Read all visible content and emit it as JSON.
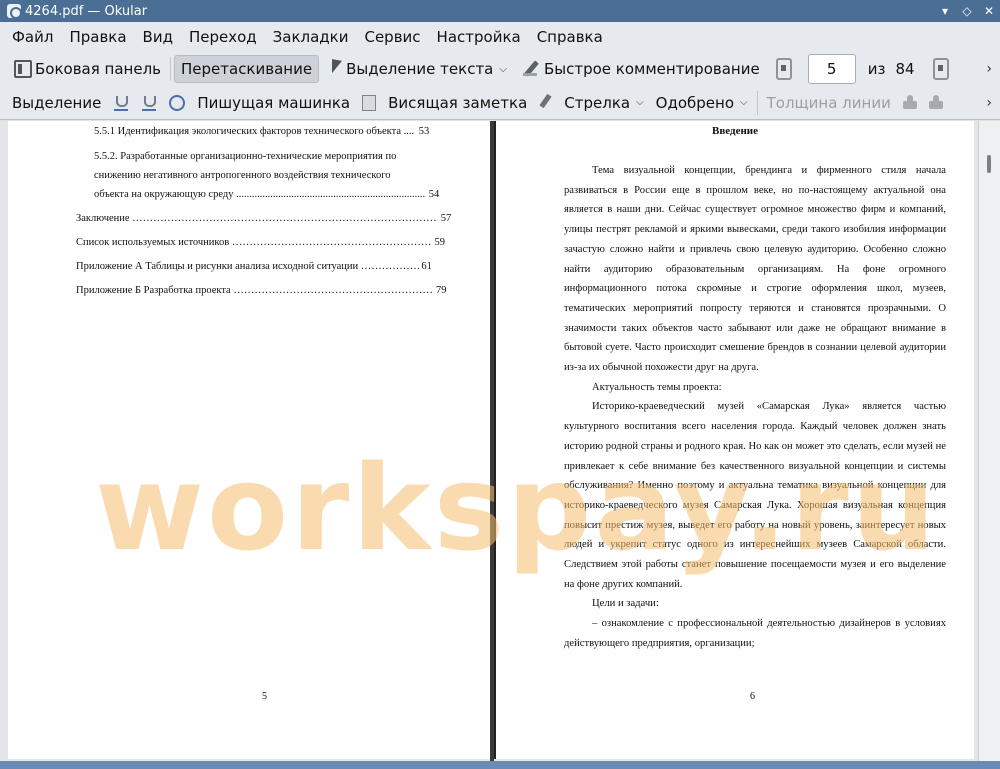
{
  "window": {
    "title": "4264.pdf — Okular",
    "minimize": "▾",
    "maximize": "◇",
    "close": "✕"
  },
  "menu": [
    "Файл",
    "Правка",
    "Вид",
    "Переход",
    "Закладки",
    "Сервис",
    "Настройка",
    "Справка"
  ],
  "toolbar1": {
    "sidebar": "Боковая панель",
    "drag": "Перетаскивание",
    "text_select": "Выделение текста",
    "quick_comment": "Быстрое комментирование",
    "page_current": "5",
    "page_of": "из",
    "page_total": "84",
    "more": "›"
  },
  "toolbar2": {
    "selection": "Выделение",
    "typewriter": "Пишущая машинка",
    "hanging_note": "Висящая заметка",
    "arrow": "Стрелка",
    "approved": "Одобрено",
    "line_width": "Толщина линии",
    "more": "›"
  },
  "left_page": {
    "toc": [
      {
        "text": "5.5.1 Идентификация экологических факторов технического объекта ....",
        "page": "53"
      },
      {
        "text": "5.5.2. Разработанные организационно-технические мероприятия по"
      },
      {
        "text": "снижению негативного антропогенного воздействия технического"
      },
      {
        "text": "объекта на окружающую среду",
        "page": "54"
      },
      {
        "text": "Заключение",
        "page": "57"
      },
      {
        "text": "Список используемых источников",
        "page": "59"
      },
      {
        "text": "Приложение А Таблицы и рисунки анализа исходной ситуации",
        "page": "61"
      },
      {
        "text": "Приложение Б Разработка проекта",
        "page": "79"
      }
    ],
    "page_number": "5"
  },
  "right_page": {
    "heading": "Введение",
    "paragraphs": [
      "Тема визуальной концепции, брендинга и фирменного стиля начала развиваться в России еще в прошлом веке, но по-настоящему актуальной она является в наши дни. Сейчас существует огромное множество фирм и компаний, улицы пестрят рекламой и яркими вывесками, среди такого изобилия информации зачастую сложно найти и привлечь свою целевую аудиторию. Особенно сложно найти аудиторию образовательным организациям. На фоне огромного информационного потока скромные и строгие оформления школ, музеев, тематических мероприятий попросту теряются и становятся прозрачными. О значимости таких объектов часто забывают или даже не обращают внимание в бытовой суете. Часто происходит смешение брендов в сознании целевой аудитории из-за их обычной похожести друг на друга.",
      "Актуальность темы проекта:",
      "Историко-краеведческий музей «Самарская Лука» является частью культурного воспитания всего населения города. Каждый человек должен знать историю родной страны и родного края. Но как он может это сделать, если музей не привлекает к себе внимание без качественного визуальной концепции и системы обслуживания? Именно поэтому и актуальна тематика визуальной концепции для историко-краеведческого музея Самарская Лука. Хорошая визуальная концепция повысит престиж музея, выведет его работу на новый уровень, заинтересует новых людей и укрепит статус одного из интереснейших музеев Самарской области. Следствием этой работы станет повышение посещаемости музея и его выделение на фоне других компаний.",
      "Цели и задачи:",
      "– ознакомление с профессиональной деятельностью дизайнеров в условиях действующего предприятия, организации;"
    ],
    "page_number": "6"
  },
  "watermark": "workspay.ru"
}
